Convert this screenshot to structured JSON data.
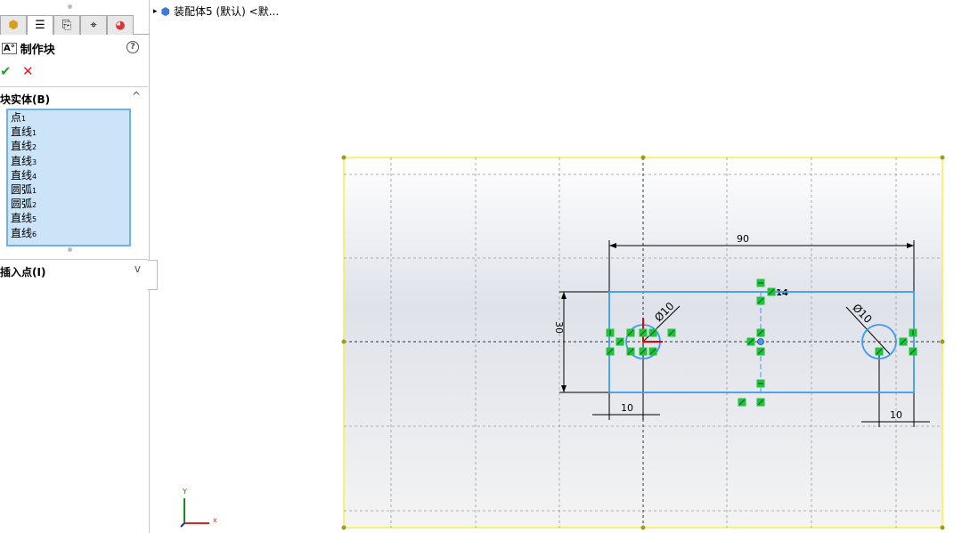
{
  "panel": {
    "title": "制作块",
    "help": "?",
    "ok": "✔",
    "cancel": "✕",
    "sections": [
      {
        "label": "块实体(B)",
        "chevron": "^"
      },
      {
        "label": "插入点(I)",
        "chevron": "v"
      }
    ],
    "entities": [
      [
        "点",
        "1"
      ],
      [
        "直线",
        "1"
      ],
      [
        "直线",
        "2"
      ],
      [
        "直线",
        "3"
      ],
      [
        "直线",
        "4"
      ],
      [
        "圆弧",
        "1"
      ],
      [
        "圆弧",
        "2"
      ],
      [
        "直线",
        "5"
      ],
      [
        "直线",
        "6"
      ]
    ]
  },
  "tree": {
    "arrow": "▸",
    "label": "装配体5 (默认) <默..."
  },
  "sketch": {
    "dims": {
      "width": "90",
      "height": "30",
      "left_offset": "10",
      "right_offset": "10",
      "dia_left": "Ø10",
      "dia_right": "Ø10",
      "tag": "14"
    },
    "axis": {
      "x": "x",
      "y": "Y"
    }
  },
  "colors": {
    "sketch": "#3d9bf0",
    "relation": "#22c23a",
    "border": "#f5f04a"
  }
}
